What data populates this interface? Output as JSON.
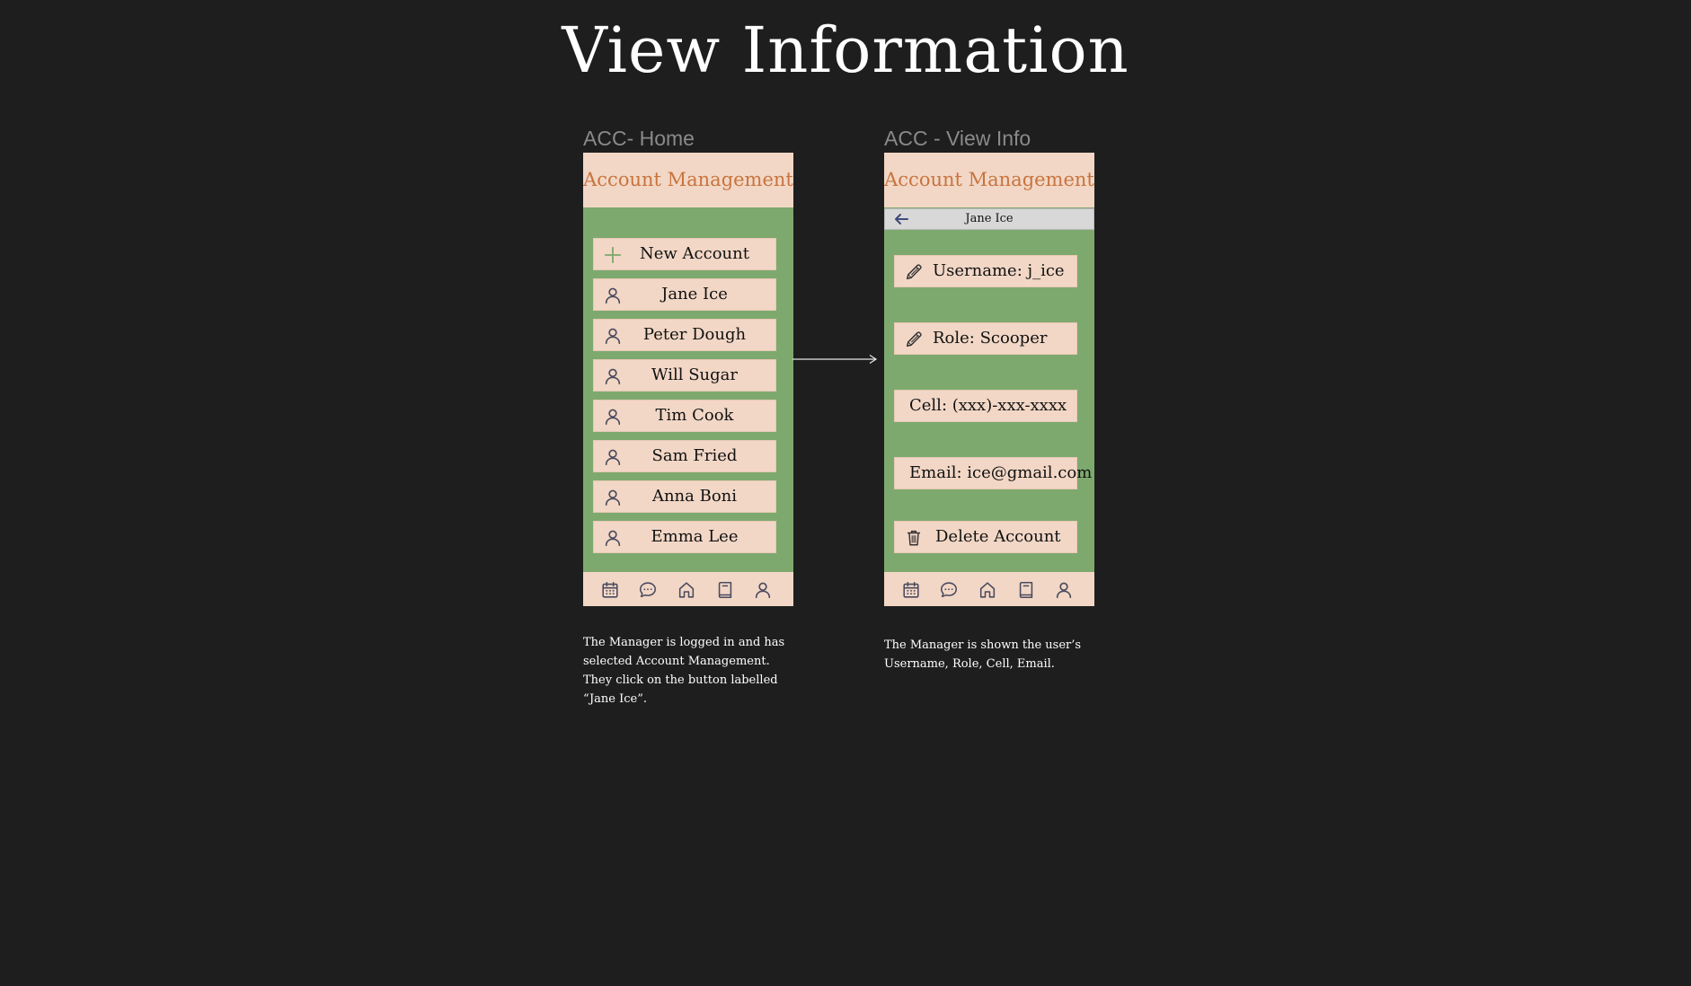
{
  "page": {
    "title": "View Information"
  },
  "colors": {
    "background": "#1e1e1e",
    "phone_green": "#7ea96e",
    "peach": "#f2d7c6",
    "header_text": "#c8743e",
    "icon_stroke": "#4a4a5e",
    "plus_icon": "#7ea96e"
  },
  "home": {
    "frame_label": "ACC- Home",
    "header": "Account Management",
    "new_account_label": "New Account",
    "accounts": [
      {
        "label": "Jane Ice",
        "icon": "user-icon"
      },
      {
        "label": "Peter Dough",
        "icon": "user-icon"
      },
      {
        "label": "Will Sugar",
        "icon": "user-icon"
      },
      {
        "label": "Tim Cook",
        "icon": "user-icon"
      },
      {
        "label": "Sam Fried",
        "icon": "user-icon"
      },
      {
        "label": "Anna Boni",
        "icon": "user-icon"
      },
      {
        "label": "Emma Lee",
        "icon": "user-icon"
      }
    ],
    "caption": "The Manager is logged in and has selected Account Management. They click on the button labelled “Jane Ice”."
  },
  "view_info": {
    "frame_label": "ACC - View Info",
    "header": "Account Management",
    "subheader_name": "Jane Ice",
    "username": "Username: j_ice",
    "role": "Role: Scooper",
    "cell": "Cell: (xxx)-xxx-xxxx",
    "email": "Email: ice@gmail.com",
    "delete_label": "Delete Account",
    "caption": "The Manager is shown the user’s Username, Role, Cell, Email."
  },
  "tabbar": {
    "icons": [
      "calendar-icon",
      "chat-icon",
      "home-icon",
      "book-icon",
      "profile-icon"
    ]
  }
}
